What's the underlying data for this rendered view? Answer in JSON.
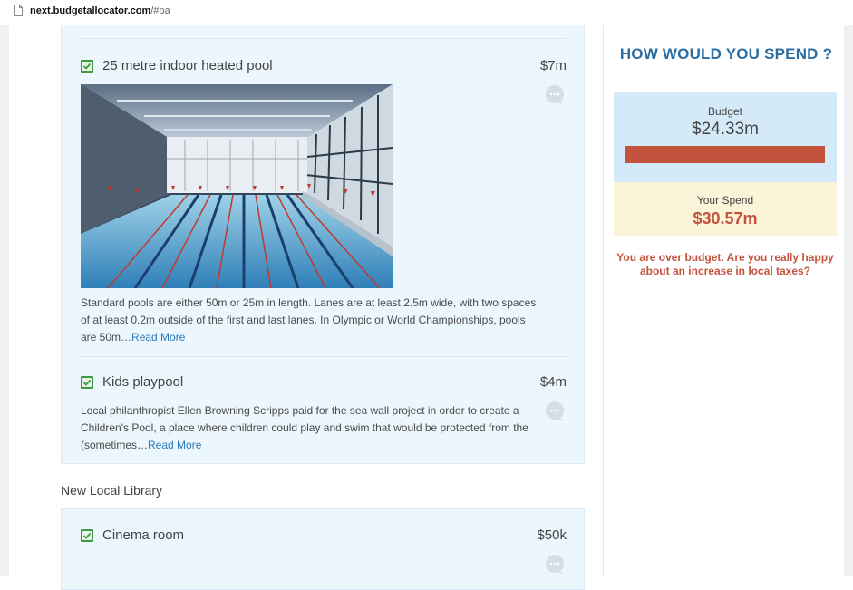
{
  "browser": {
    "url_domain": "next.budgetallocator.com",
    "url_path": "/#ba"
  },
  "items": [
    {
      "title": "25 metre indoor heated pool",
      "cost": "$7m",
      "checked": true,
      "description": "Standard pools are either 50m or 25m in length. Lanes are at least 2.5m wide, with two spaces of at least 0.2m outside of the first and last lanes. In Olympic or World Championships, pools are 50m…",
      "read_more": "Read More"
    },
    {
      "title": "Kids playpool",
      "cost": "$4m",
      "checked": true,
      "description": "Local philanthropist Ellen Browning Scripps paid for the sea wall project in order to create a Children's Pool, a place where children could play and swim that would be protected from the (sometimes…",
      "read_more": "Read More"
    },
    {
      "title": "Cinema room",
      "cost": "$50k",
      "checked": true
    }
  ],
  "sections": {
    "library_heading": "New Local Library"
  },
  "sidebar": {
    "title": "HOW WOULD YOU SPEND ?",
    "budget_label": "Budget",
    "budget_value": "$24.33m",
    "spend_label": "Your Spend",
    "spend_value": "$30.57m",
    "warning": "You are over budget. Are you really happy about an increase in local taxes?",
    "bar_color": "#c4533e",
    "accent_color": "#2a6ea3"
  },
  "icons": {
    "page": "page-icon",
    "checkbox": "checkbox-checked-icon",
    "comment": "comment-bubble-icon"
  }
}
